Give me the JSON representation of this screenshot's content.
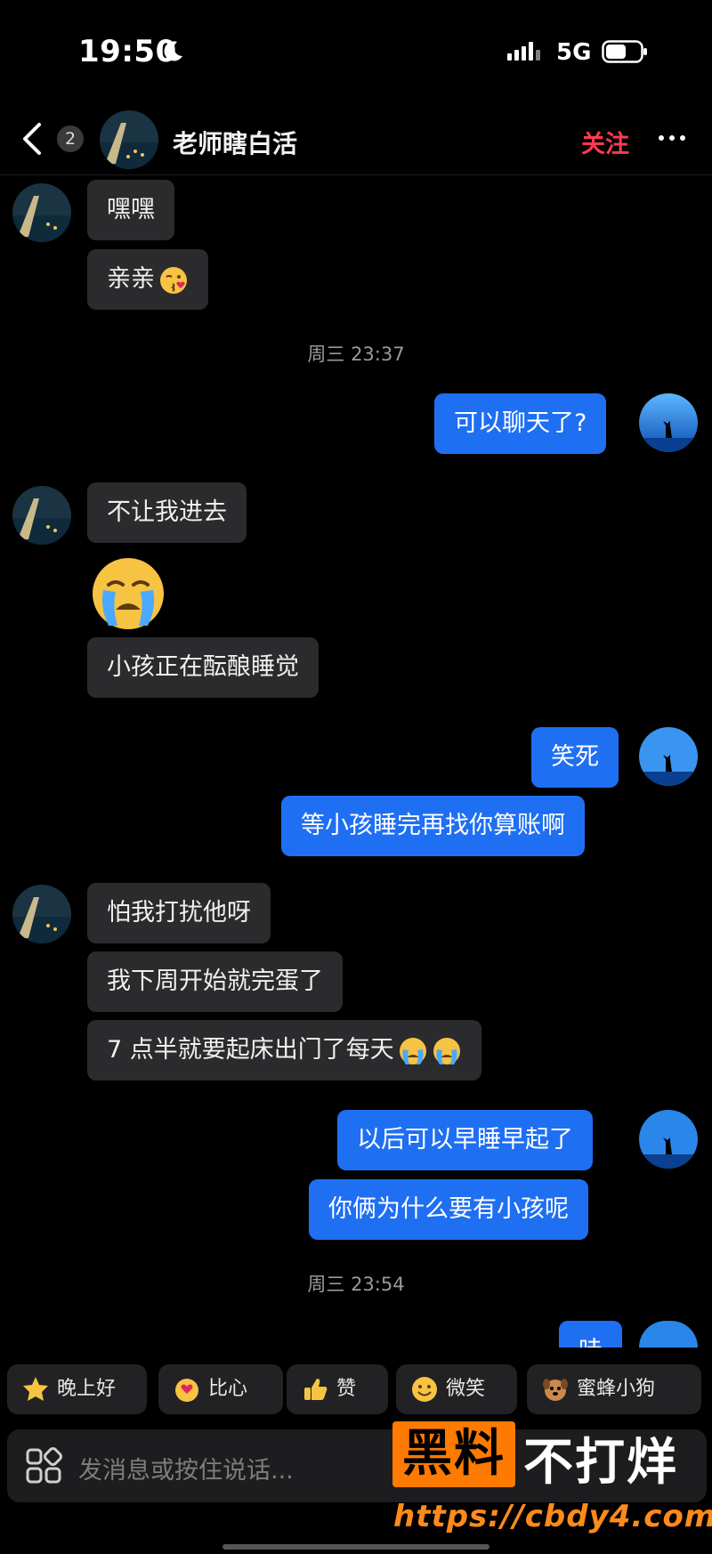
{
  "status_bar": {
    "time": "19:50",
    "network": "5G",
    "icons": [
      "moon-icon",
      "signal-icon",
      "battery-icon"
    ]
  },
  "header": {
    "unread_count": "2",
    "contact_name": "老师瞎白活",
    "follow_label": "关注",
    "icons": [
      "back-chevron-icon",
      "more-dots-icon"
    ]
  },
  "messages": {
    "m1": "嘿嘿",
    "m2": "亲亲",
    "ts1": "周三 23:37",
    "m3": "可以聊天了?",
    "m4": "不让我进去",
    "m5_emoji": "loudly-crying-face-emoji",
    "m6": "小孩正在酝酿睡觉",
    "m7": "笑死",
    "m8": "等小孩睡完再找你算账啊",
    "m9": "怕我打扰他呀",
    "m10": "我下周开始就完蛋了",
    "m11": "7 点半就要起床出门了每天",
    "m12": "以后可以早睡早起了",
    "m13": "你俩为什么要有小孩呢",
    "ts2": "周三 23:54",
    "m14_partial": "哇"
  },
  "quick_replies": [
    {
      "label": "晚上好",
      "icon": "star-face-icon"
    },
    {
      "label": "比心",
      "icon": "heart-hands-icon"
    },
    {
      "label": "赞",
      "icon": "thumbs-up-icon"
    },
    {
      "label": "微笑",
      "icon": "smile-icon"
    },
    {
      "label": "蜜蜂小狗",
      "icon": "dog-icon"
    }
  ],
  "input": {
    "placeholder": "发消息或按住说话..."
  },
  "watermark": {
    "box_text": "黑料",
    "text": "不打烊",
    "url": "https://cbdy4.com"
  },
  "colors": {
    "bg": "#000000",
    "left_bubble": "#2b2b2d",
    "right_bubble": "#1f6ff2",
    "follow": "#ff3b4f",
    "watermark": "#ff7a00"
  }
}
